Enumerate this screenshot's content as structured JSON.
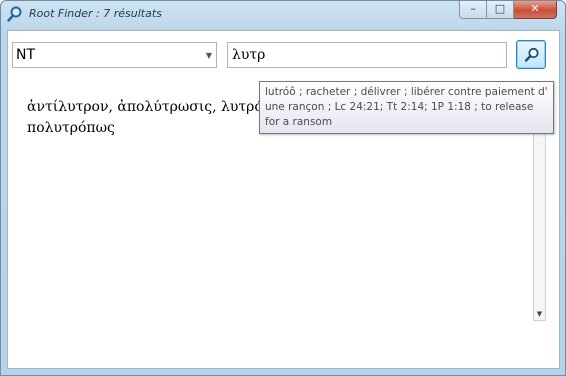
{
  "window": {
    "title": "Root Finder : 7 résultats",
    "minimize_glyph": "–",
    "maximize_glyph": "□",
    "close_glyph": "✕"
  },
  "toolbar": {
    "source_value": "NT",
    "query_value": "λυτρ",
    "search_icon": "magnifier-icon"
  },
  "results": {
    "text": "ἀντίλυτρον, ἀπολύτρωσις, λυτρόω, λύτρον, λύτρωσις, λυτρωτής, πολυτρόπως"
  },
  "tooltip": {
    "text": "lutróô ; racheter ; délivrer ; libérer contre paiement d' une rançon ; Lc 24:21; Tt 2:14; 1P  1:18 ; to release for a ransom"
  },
  "scrollbar": {
    "up_glyph": "▲",
    "down_glyph": "▼"
  }
}
